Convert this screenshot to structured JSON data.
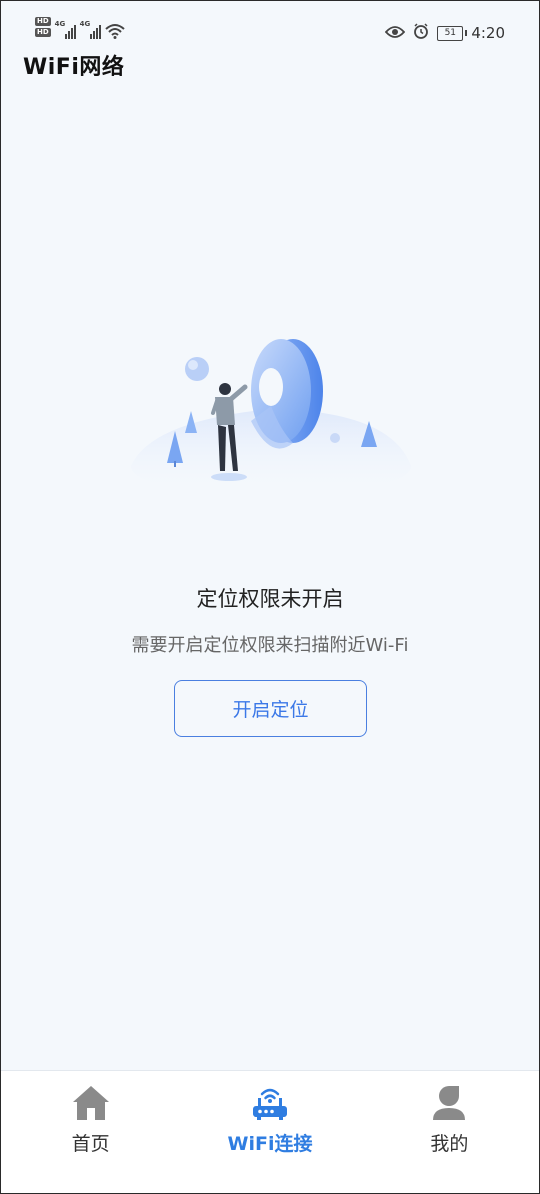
{
  "status_bar": {
    "hd_badge_1": "HD",
    "hd_badge_2": "HD",
    "network_1": "4G",
    "network_2": "4G",
    "battery": "51",
    "time": "4:20",
    "icons": [
      "eye-icon",
      "alarm-icon",
      "wifi-icon",
      "signal-icon",
      "battery-icon"
    ]
  },
  "header": {
    "title": "WiFi网络"
  },
  "empty_state": {
    "title": "定位权限未开启",
    "description": "需要开启定位权限来扫描附近Wi-Fi",
    "button_label": "开启定位",
    "illustration": "location-permission-illustration"
  },
  "bottom_nav": {
    "items": [
      {
        "label": "首页",
        "icon": "home-icon",
        "active": false
      },
      {
        "label": "WiFi连接",
        "icon": "router-icon",
        "active": true
      },
      {
        "label": "我的",
        "icon": "profile-icon",
        "active": false
      }
    ]
  },
  "colors": {
    "accent": "#2f7de1",
    "button_border": "#4a7fe0",
    "background": "#f4f8fc",
    "inactive_icon": "#8a8a8a"
  }
}
